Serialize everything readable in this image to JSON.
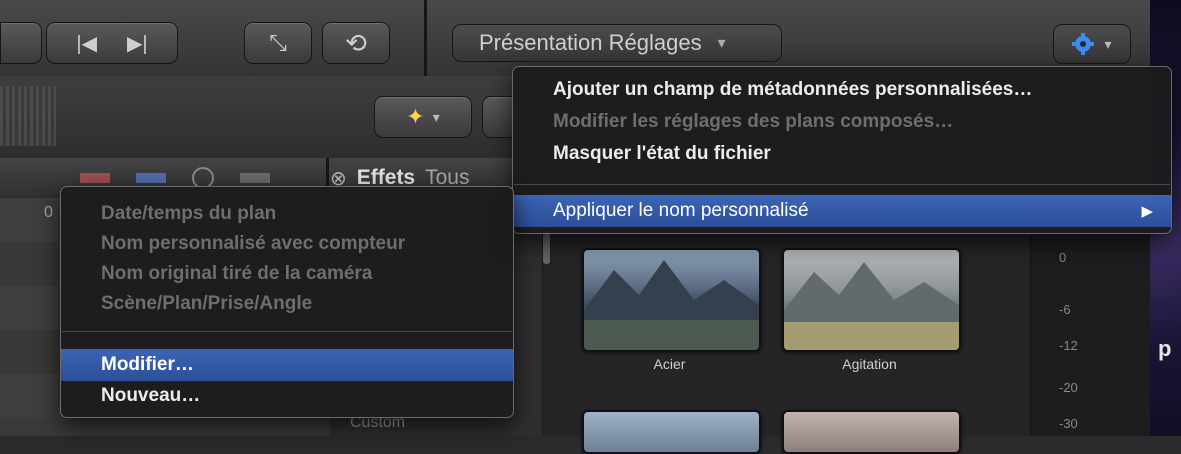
{
  "toolbar": {
    "presentation_label": "Présentation Réglages",
    "presentation_caret": "▾",
    "prev_glyph": "|◀",
    "next_glyph": "▶|",
    "fullscreen_glyph": "⤡",
    "loop_glyph": "⟲",
    "gear_caret": "▾",
    "magic_caret": "▾"
  },
  "effects_tab": {
    "close_glyph": "⊗",
    "label": "Effets",
    "filter": "Tous"
  },
  "settings_menu": {
    "items": [
      {
        "label": "Ajouter un champ de métadonnées personnalisées…",
        "enabled": true
      },
      {
        "label": "Modifier les réglages des plans composés…",
        "enabled": false
      },
      {
        "label": "Masquer l'état du fichier",
        "enabled": true
      },
      {
        "label": "Appliquer le nom personnalisé",
        "enabled": true,
        "selected": true,
        "submenu_arrow": "▶"
      }
    ]
  },
  "name_submenu": {
    "items": [
      {
        "label": "Date/temps du plan",
        "enabled": false
      },
      {
        "label": "Nom personnalisé avec compteur",
        "enabled": false
      },
      {
        "label": "Nom original tiré de la caméra",
        "enabled": false
      },
      {
        "label": "Scène/Plan/Prise/Angle",
        "enabled": false
      },
      {
        "label": "Modifier…",
        "enabled": true,
        "selected": true
      },
      {
        "label": "Nouveau…",
        "enabled": true
      }
    ]
  },
  "browser": {
    "thumbnails": [
      {
        "label": "Acier"
      },
      {
        "label": "Agitation"
      }
    ],
    "sidebar_partial_item": "Custom"
  },
  "vu_meter": {
    "labels": [
      "0",
      "-6",
      "-12",
      "-20",
      "-30"
    ]
  },
  "edge_fragment": "p",
  "left_column_fragment": "0",
  "colors": {
    "menu_background": "#1c1c1e",
    "selection": "#2f57a8",
    "gear_accent": "#3d8cf0",
    "disabled_text": "#6e6e70"
  }
}
